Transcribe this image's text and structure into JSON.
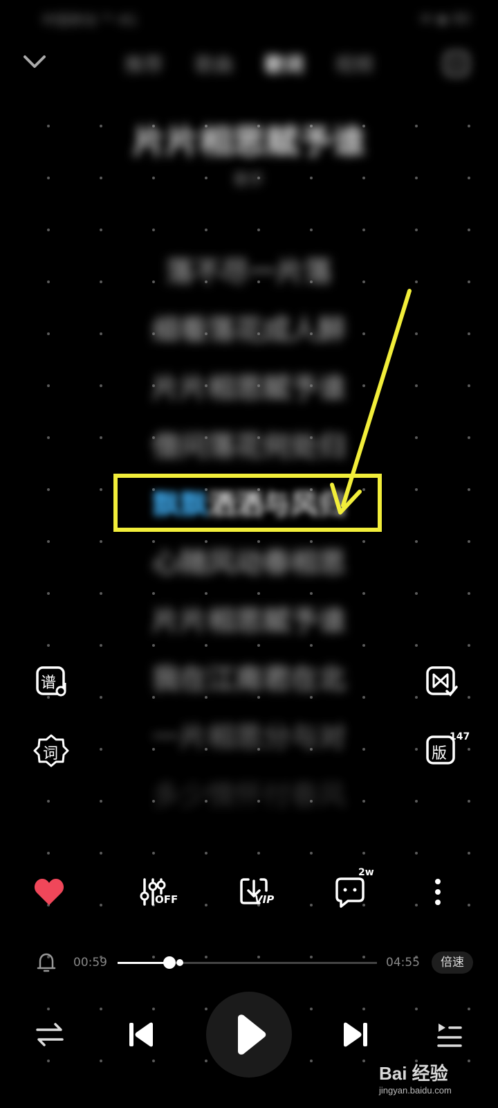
{
  "status_bar": {
    "left_text": "中国移动 ᵀᴺ 4G",
    "right_text": "✉ ◉ 80"
  },
  "header": {
    "tabs": [
      "推荐",
      "歌曲",
      "歌词",
      "视频"
    ],
    "active_tab_index": 2
  },
  "song": {
    "title": "片片相思赋予谁",
    "artist": "歌手"
  },
  "lyrics": [
    "落不尽一片落",
    "细看落花成人醉",
    "片片相思赋予谁",
    "借问落花何处归",
    "",
    "心随风动春相思",
    "片片相思赋予谁",
    "我在江南君在北",
    "一片相思分与对",
    "多少情怀付春风"
  ],
  "active_lyric": {
    "highlighted": "飘飘",
    "rest": "洒洒与风归",
    "index": 4
  },
  "side_controls": {
    "sheet_label": "谱",
    "lyric_label": "词",
    "version_label": "版",
    "version_count": "147"
  },
  "actions": {
    "eq_label": "OFF",
    "download_label": "VIP",
    "comment_count": "2w"
  },
  "progress": {
    "elapsed": "00:59",
    "duration": "04:55",
    "fraction": 0.2,
    "speed_label": "倍速"
  },
  "watermark": {
    "brand": "Bai 经验",
    "url": "jingyan.baidu.com"
  },
  "colors": {
    "like": "#f0475a",
    "lyric_highlight": "#3aa0e0",
    "annotation": "#f2ee3a"
  }
}
